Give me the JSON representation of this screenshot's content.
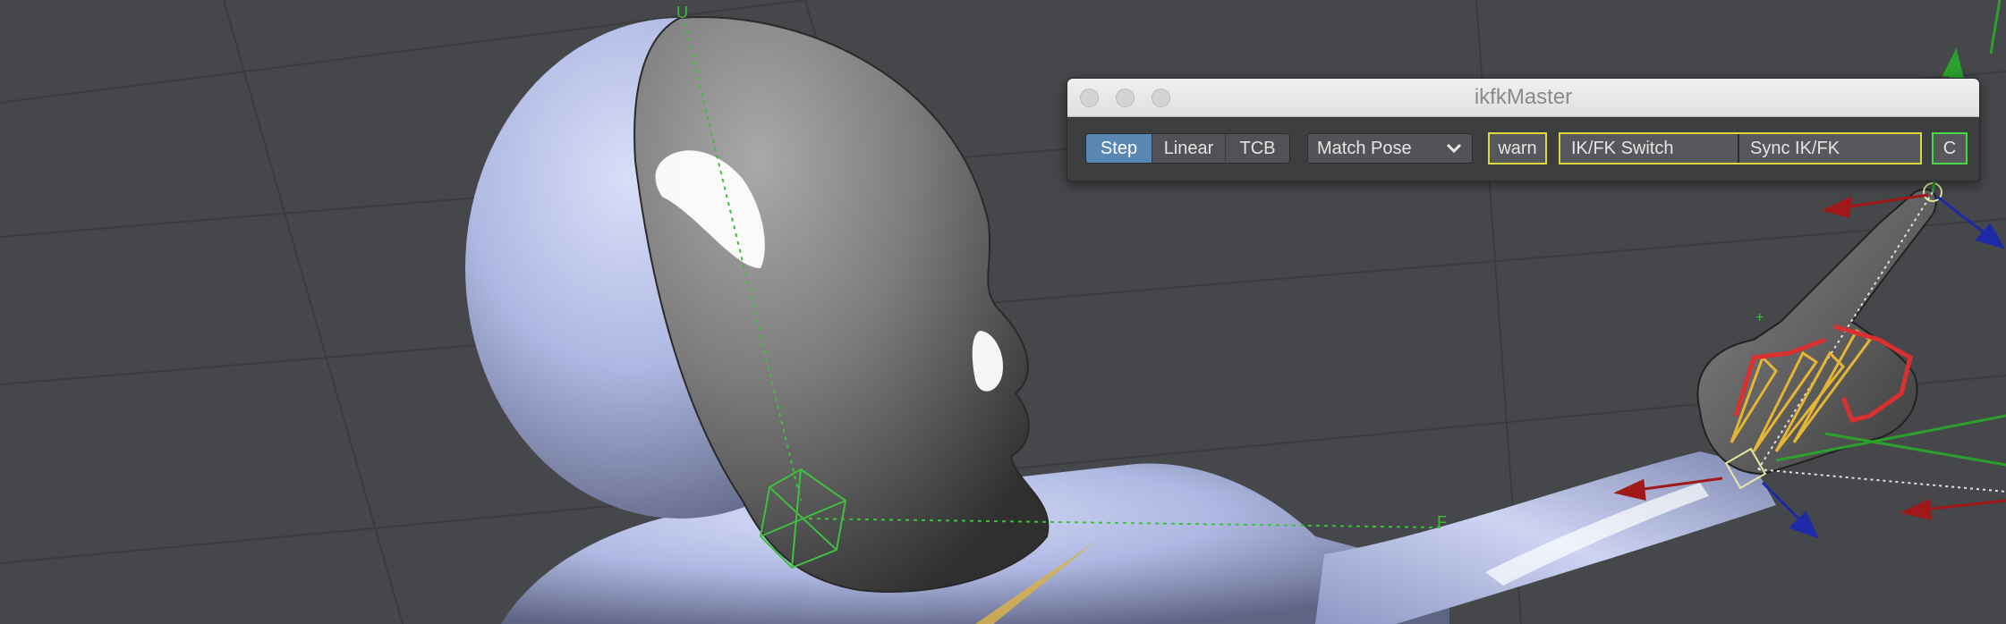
{
  "window": {
    "title": "ikfkMaster"
  },
  "toolbar": {
    "interpolation": {
      "options": [
        "Step",
        "Linear",
        "TCB"
      ],
      "selected": "Step"
    },
    "match_pose": {
      "value": "Match Pose"
    },
    "warn_label": "warn",
    "ikfk_switch_label": "IK/FK Switch",
    "sync_ikfk_label": "Sync IK/FK",
    "c_label": "C"
  },
  "viewport": {
    "axis_labels": {
      "up": "U",
      "forward": "F"
    }
  },
  "colors": {
    "viewport_bg": "#45474a",
    "active_segment": "#5a86b4",
    "highlight_yellow": "#d9d93b",
    "highlight_green": "#46d846",
    "mesh_blue": "#b5bfe6",
    "mesh_gray": "#7c7c7c"
  }
}
